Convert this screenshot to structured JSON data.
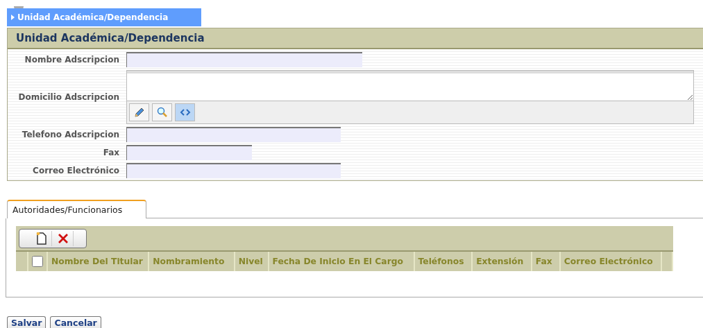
{
  "breadcrumb": {
    "label": "Unidad Académica/Dependencia"
  },
  "panel": {
    "title": "Unidad Académica/Dependencia",
    "fields": [
      {
        "kind": "input",
        "label": "Nombre Adscripcion"
      },
      {
        "kind": "textarea",
        "label": "Domicilio Adscripcion",
        "tools": [
          {
            "kind": "edit",
            "selected": false
          },
          {
            "kind": "preview",
            "selected": false
          },
          {
            "kind": "source",
            "selected": true
          }
        ]
      },
      {
        "kind": "input",
        "label": "Telefono Adscripcion"
      },
      {
        "kind": "input",
        "label": "Fax"
      },
      {
        "kind": "input",
        "label": "Correo Electrónico"
      }
    ]
  },
  "tabs": [
    {
      "label": "Autoridades/Funcionarios",
      "selected": true
    }
  ],
  "grid": {
    "toolbar": [
      {
        "kind": "new"
      },
      {
        "kind": "delete"
      }
    ],
    "select_all": {
      "checked": false
    },
    "columns": [
      "Nombre Del Titular",
      "Nombramiento",
      "Nivel",
      "Fecha De Inicio En El Cargo",
      "Teléfonos",
      "Extensión",
      "Fax",
      "Correo Electrónico"
    ]
  },
  "buttons": [
    "Salvar",
    "Cancelar"
  ]
}
